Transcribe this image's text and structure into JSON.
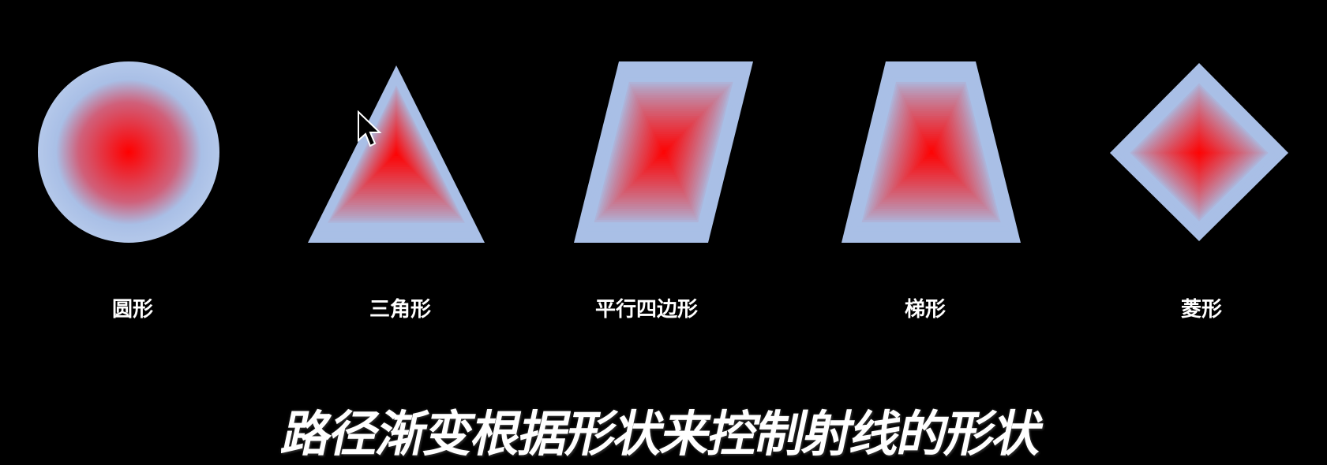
{
  "colors": {
    "edge": "#a9bfe6",
    "center": "#ff0000",
    "background": "#000000"
  },
  "shapes": [
    {
      "id": "circle",
      "label": "圆形"
    },
    {
      "id": "triangle",
      "label": "三角形"
    },
    {
      "id": "parallelogram",
      "label": "平行四边形"
    },
    {
      "id": "trapezoid",
      "label": "梯形"
    },
    {
      "id": "rhombus",
      "label": "菱形"
    }
  ],
  "subtitle": "路径渐变根据形状来控制射线的形状",
  "cursor_icon": "arrow-pointer"
}
